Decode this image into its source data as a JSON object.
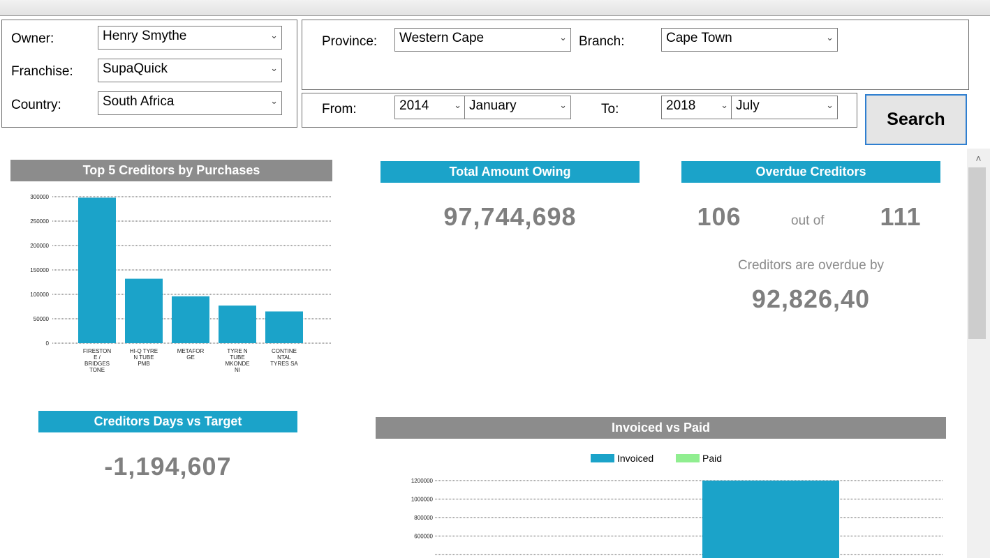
{
  "filters": {
    "owner_label": "Owner:",
    "owner_value": "Henry Smythe",
    "franchise_label": "Franchise:",
    "franchise_value": "SupaQuick",
    "country_label": "Country:",
    "country_value": "South Africa",
    "province_label": "Province:",
    "province_value": "Western Cape",
    "branch_label": "Branch:",
    "branch_value": "Cape Town",
    "from_label": "From:",
    "from_year": "2014",
    "from_month": "January",
    "to_label": "To:",
    "to_year": "2018",
    "to_month": "July",
    "search_label": "Search"
  },
  "cards": {
    "total_owing_title": "Total Amount Owing",
    "total_owing_value": "97,744,698",
    "overdue_title": "Overdue Creditors",
    "overdue_count": "106",
    "overdue_outof": "out of",
    "overdue_total": "111",
    "overdue_caption": "Creditors are overdue by",
    "overdue_amount": "92,826,40",
    "days_title": "Creditors Days vs Target",
    "days_value": "-1,194,607"
  },
  "icons": {
    "dropdown": "chevron-down-icon",
    "scroll_up": "chevron-up-icon"
  },
  "colors": {
    "accent": "#1ba3c9",
    "header_gray": "#8c8c8c",
    "paid": "#90ee90"
  },
  "chart_data": [
    {
      "type": "bar",
      "title": "Top 5 Creditors by Purchases",
      "categories": [
        "FIRESTONE / BRIDGESTONE",
        "HI-Q TYRE N TUBE PMB",
        "METAFORGE",
        "TYRE N TUBE MKONDENI",
        "CONTINENTAL TYRES SA"
      ],
      "category_label_lines": [
        [
          "FIRESTON",
          "E /",
          "BRIDGES",
          "TONE"
        ],
        [
          "HI-Q TYRE",
          "N TUBE",
          "PMB"
        ],
        [
          "METAFOR",
          "GE"
        ],
        [
          "TYRE N",
          "TUBE",
          "MKONDE",
          "NI"
        ],
        [
          "CONTINE",
          "NTAL",
          "TYRES SA"
        ]
      ],
      "values": [
        298000,
        132000,
        96000,
        77000,
        65000
      ],
      "yticks": [
        "0",
        "50000",
        "100000",
        "150000",
        "200000",
        "250000",
        "300000"
      ],
      "ylim": [
        0,
        300000
      ],
      "grid": true,
      "color": "#1ba3c9"
    },
    {
      "type": "bar",
      "title": "Invoiced vs Paid",
      "series": [
        {
          "name": "Invoiced",
          "color": "#1ba3c9"
        },
        {
          "name": "Paid",
          "color": "#90ee90"
        }
      ],
      "visible_bar_value": 1200000,
      "yticks": [
        "600000",
        "800000",
        "1000000",
        "1200000"
      ],
      "grid": true,
      "legend": "top-center"
    }
  ]
}
